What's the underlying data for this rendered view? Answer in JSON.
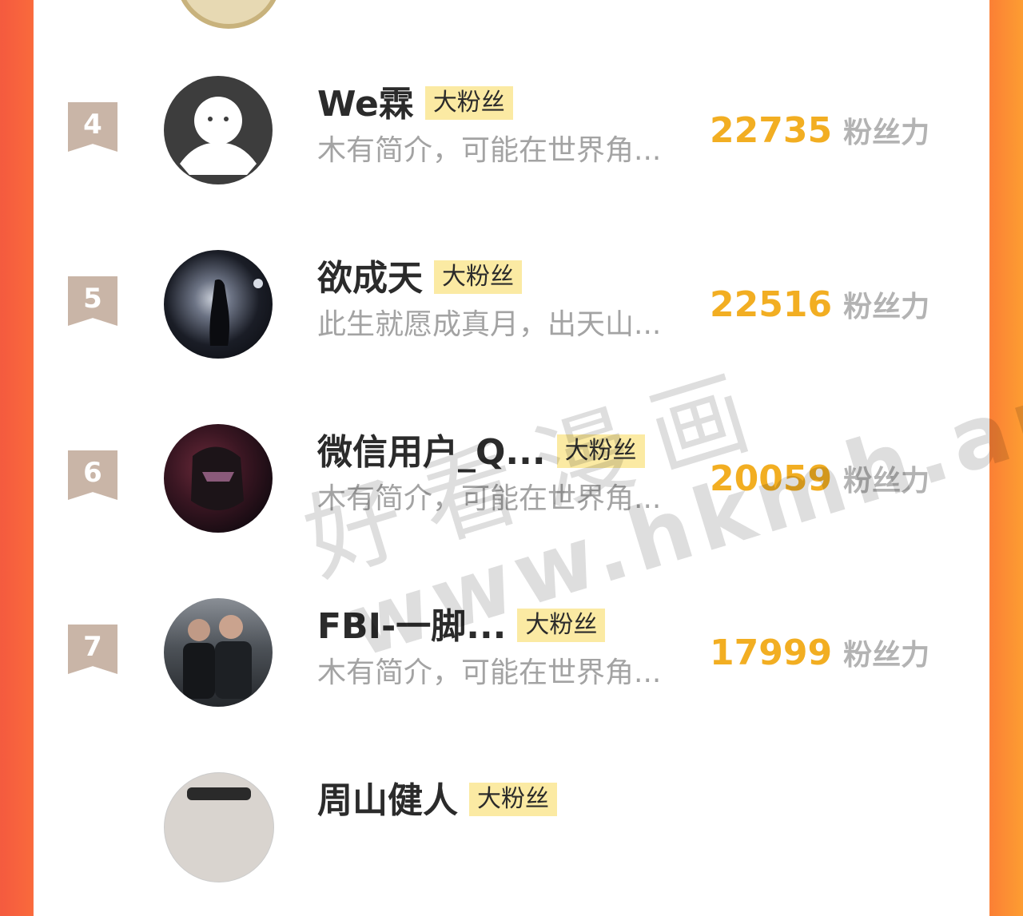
{
  "rows": [
    {
      "rank": "4",
      "name": "We霖",
      "badge": "大粉丝",
      "bio": "木有简介，可能在世界角...",
      "fans": "22735",
      "unit": "粉丝力"
    },
    {
      "rank": "5",
      "name": "欲成天",
      "badge": "大粉丝",
      "bio": "此生就愿成真月，出天山...",
      "fans": "22516",
      "unit": "粉丝力"
    },
    {
      "rank": "6",
      "name": "微信用户_Q...",
      "badge": "大粉丝",
      "bio": "木有简介，可能在世界角...",
      "fans": "20059",
      "unit": "粉丝力"
    },
    {
      "rank": "7",
      "name": "FBI-一脚...",
      "badge": "大粉丝",
      "bio": "木有简介，可能在世界角...",
      "fans": "17999",
      "unit": "粉丝力"
    },
    {
      "name": "周山健人",
      "badge": "大粉丝"
    }
  ],
  "watermark": {
    "cn": "好看漫画",
    "url": "www.hkmh.app"
  },
  "colors": {
    "left_edge": "#f45a3f",
    "right_edge": "#fd9d32",
    "fans_number": "#f2ae22",
    "badge_bg": "#fbeaa3",
    "rank_bg": "#c9b5a7"
  }
}
